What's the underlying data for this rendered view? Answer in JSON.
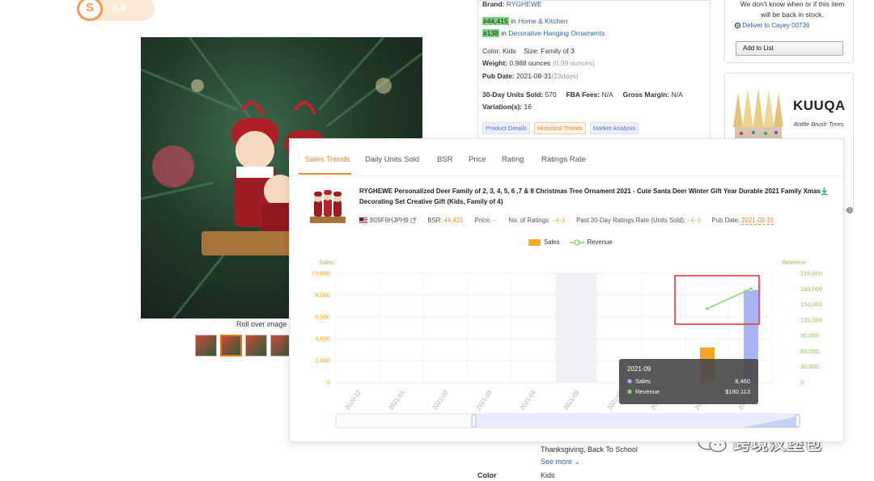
{
  "brand_logo": {
    "letter": "S",
    "text": "0.0"
  },
  "product_area": {
    "roll_over_text": "Roll over image",
    "thumb_count": 4
  },
  "info": {
    "brand_label": "Brand:",
    "brand_value": "RYGHEWE",
    "rank1": "#44,415",
    "rank1_in": "in",
    "rank1_cat": "Home & Kitchen",
    "rank2": "#138",
    "rank2_in": "in",
    "rank2_cat": "Decorative Hanging Ornaments",
    "color_line": "Color: Kids",
    "size_line": "Size: Family of 3",
    "weight_label": "Weight:",
    "weight_value": "0.988 ounces",
    "weight_alt": "(0.99 ounces)",
    "pub_label": "Pub Date:",
    "pub_value": "2021-08-31",
    "pub_age": "(23days)",
    "units_label": "30-Day Units Sold:",
    "units_value": "570",
    "fba_label": "FBA Fees:",
    "fba_value": "N/A",
    "margin_label": "Gross Margin:",
    "margin_value": "N/A",
    "variations_label": "Variation(s):",
    "variations_value": "16",
    "tabs": [
      "Product Details",
      "Historical Trends",
      "Market Analysis"
    ]
  },
  "buy_box": {
    "text": "We don't know when or if this item will be back in stock.",
    "deliver": "Deliver to Cayey 00736",
    "add_list": "Add to List"
  },
  "ad": {
    "logo": "KUUQA",
    "subtitle": "Bottle Brush Trees"
  },
  "bottom": {
    "occasions": "Thanksgiving, Back To School",
    "see_more": "See more",
    "color_label": "Color",
    "color_value": "Kids"
  },
  "watermark": {
    "text": "跨境汉堡包"
  },
  "panel": {
    "tabs": [
      "Sales Trends",
      "Daily Units Sold",
      "BSR",
      "Price",
      "Rating",
      "Ratings Rate"
    ],
    "active_tab": "Sales Trends",
    "product_title": "RYGHEWE Personalized Deer Family of 2, 3, 4, 5, 6 ,7 & 8 Christmas Tree Ornament 2021 - Cute Santa Deer Winter Gift Year Durable 2021 Family Xmas Decorating Set Creative Gift (Kids, Family of 4)",
    "asin": "B09F9HJPH9",
    "bsr_label": "BSR:",
    "bsr_value": "44,415",
    "price_label": "Price:",
    "price_value": "--",
    "ratings_label": "No. of Ratings:",
    "ratings_value": "--(--)",
    "rate_label": "Past 30-Day Ratings Rate (Units Sold):",
    "rate_value": "--(--)",
    "pub_label": "Pub Date:",
    "pub_value": "2021-08-31"
  },
  "colors": {
    "accent": "#f0892d",
    "sales_bar": "#f5a623",
    "revenue_line": "#8fd46e",
    "highlight_bar": "#a9b6f5",
    "red_box": "#e53935"
  },
  "chart_data": {
    "type": "bar",
    "x": [
      "2020-12",
      "2021-01",
      "2021-02",
      "2021-03",
      "2021-04",
      "2021-05",
      "2021-06",
      "2021-07",
      "2021-08",
      "2021-09"
    ],
    "series": [
      {
        "name": "Sales",
        "type": "bar",
        "axis": "left",
        "values": [
          null,
          null,
          null,
          null,
          null,
          null,
          null,
          null,
          3200,
          8460
        ]
      },
      {
        "name": "Revenue",
        "type": "line",
        "axis": "right",
        "values": [
          null,
          null,
          null,
          null,
          null,
          null,
          null,
          null,
          142000,
          180113
        ]
      }
    ],
    "ylabel_left": "Sales",
    "ylabel_right": "Revenue",
    "ylim_left": [
      0,
      10000
    ],
    "ylim_right": [
      0,
      210000
    ],
    "yticks_left": [
      "0",
      "2,000",
      "4,000",
      "6,000",
      "8,000",
      "10,000"
    ],
    "yticks_right": [
      "0",
      "30,000",
      "60,000",
      "90,000",
      "120,000",
      "150,000",
      "180,000",
      "210,000"
    ],
    "grid": true,
    "legend": "top-center",
    "tooltip": {
      "title": "2021-09",
      "rows": [
        {
          "name": "Sales",
          "value": "8,460"
        },
        {
          "name": "Revenue",
          "value": "$180,113"
        }
      ]
    }
  }
}
